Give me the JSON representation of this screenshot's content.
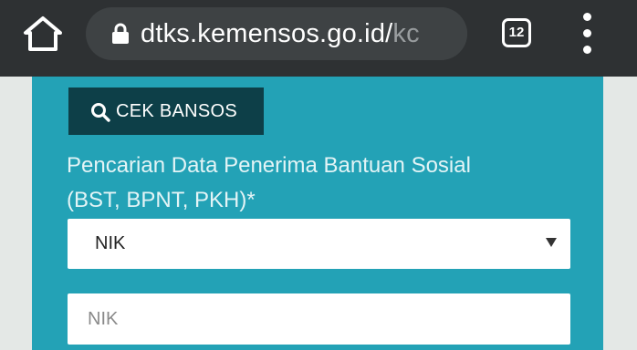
{
  "browser": {
    "url_main": "dtks.kemensos.go.id/",
    "url_tail": "kc",
    "tab_count": "12",
    "icons": {
      "home": "home-icon",
      "lock": "lock-icon",
      "tabs": "tab-switcher-icon",
      "menu": "more-vert-icon"
    }
  },
  "page": {
    "search_button_label": "CEK BANSOS",
    "search_button_icon": "search-icon",
    "form_label_line1": "Pencarian Data Penerima Bantuan Sosial",
    "form_label_line2": "(BST, BPNT, PKH)*",
    "select": {
      "selected": "NIK",
      "caret_icon": "caret-down-icon"
    },
    "nik_input": {
      "value": "",
      "placeholder": "NIK"
    }
  },
  "colors": {
    "browser_bar": "#2e3133",
    "url_pill": "#3e4244",
    "panel": "#23a2b6",
    "button_bg": "#0d3f48",
    "label_text": "#e3f4f6"
  }
}
